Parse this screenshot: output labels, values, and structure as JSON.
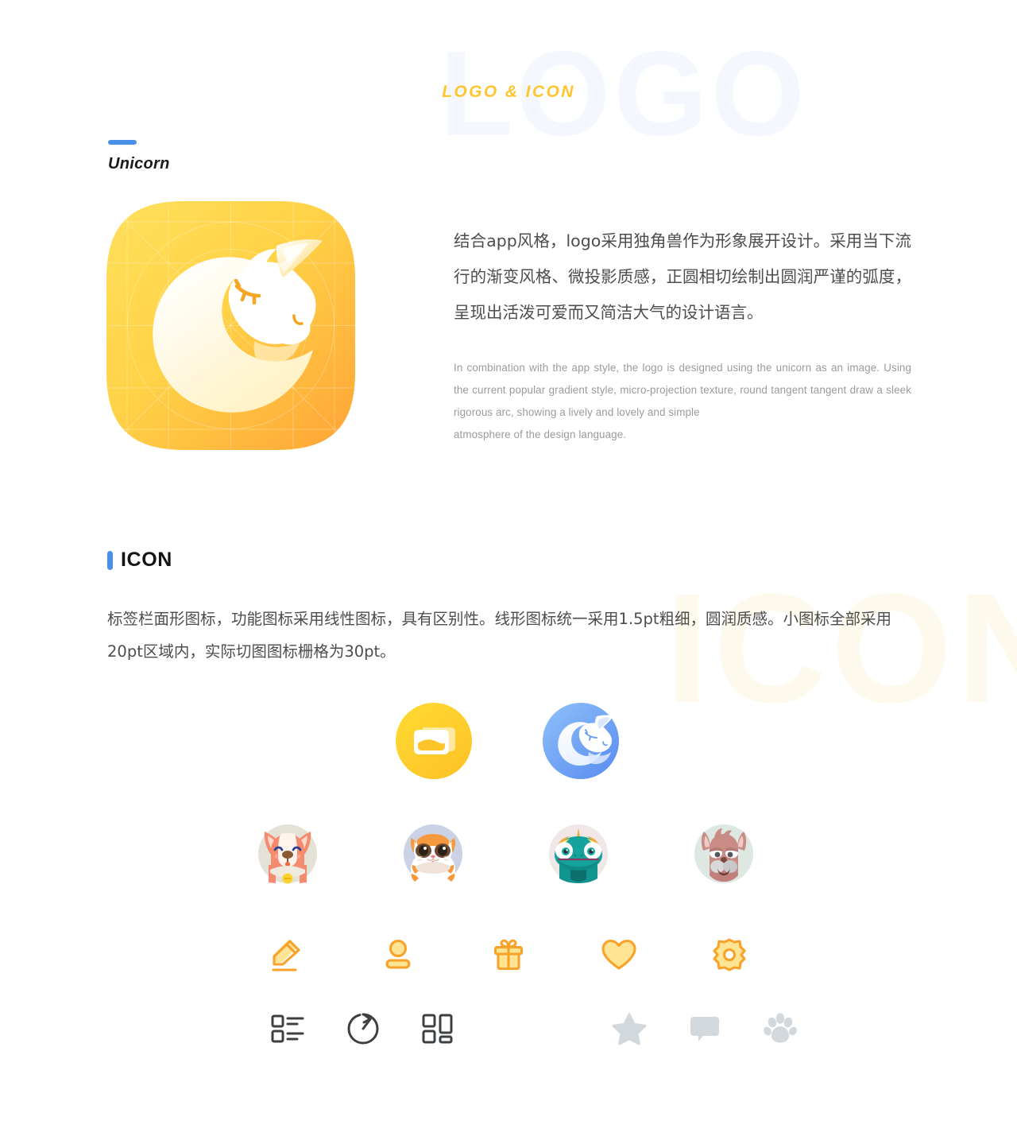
{
  "watermarks": {
    "logo": "LOGO",
    "icon": "ICON",
    "logo_color": "#f4f8fe",
    "icon_color": "#fdfaed"
  },
  "header": {
    "title": "LOGO & ICON",
    "title_color": "#ffc52e"
  },
  "sections": [
    {
      "id": "unicorn",
      "accent_color": "#4a90e8",
      "heading": "Unicorn",
      "app_icon": {
        "name": "unicorn-app-icon",
        "shape": "squircle",
        "gradient_from": "#ffd84d",
        "gradient_to": "#ffa93a",
        "subject": "white unicorn head with striped golden horn",
        "has_construction_grid": true
      },
      "copy_cn": "结合app风格，logo采用独角兽作为形象展开设计。采用当下流行的渐变风格、微投影质感，正圆相切绘制出圆润严谨的弧度，呈现出活泼可爱而又简洁大气的设计语言。",
      "copy_en": [
        "In combination with the app style, the logo is designed using the unicorn as an image. Using the current popular gradient style, micro-projection texture, round tangent tangent draw a sleek rigorous arc, showing a lively and lovely and simple",
        "atmosphere of the design language."
      ]
    },
    {
      "id": "icon",
      "accent_color": "#4a90e8",
      "heading": "ICON",
      "description": "标签栏面形图标，功能图标采用线性图标，具有区别性。线形图标统一采用1.5pt粗细，圆润质感。小图标全部采用20pt区域内，实际切图图标栅格为30pt。"
    }
  ],
  "icon_rows": [
    {
      "id": "tabbar-filled-icons",
      "style": "filled-circle",
      "items": [
        {
          "name": "gallery-icon",
          "label": "gallery",
          "circle_color": "#ffd42e",
          "glyph_color": "#ffffff"
        },
        {
          "name": "unicorn-icon",
          "label": "unicorn",
          "circle_color": "#6fa8f5",
          "glyph_color": "#ffffff"
        }
      ]
    },
    {
      "id": "animal-avatars",
      "style": "avatar-circle",
      "items": [
        {
          "name": "dog-avatar-icon",
          "label": "corgi dog",
          "circle_color": "#e3e0d6",
          "body_color": "#f58b6e"
        },
        {
          "name": "cat-avatar-icon",
          "label": "cat",
          "circle_color": "#cdd2e6",
          "body_color": "#f5993c"
        },
        {
          "name": "chameleon-avatar-icon",
          "label": "chameleon",
          "circle_color": "#f0e6e6",
          "body_color": "#18a09c"
        },
        {
          "name": "alpaca-avatar-icon",
          "label": "alpaca",
          "circle_color": "#dde8e2",
          "body_color": "#c98b85"
        }
      ]
    },
    {
      "id": "line-icons-yellow",
      "style": "line-icon",
      "stroke_color": "#f9a22a",
      "fill_color": "#ffe493",
      "items": [
        {
          "name": "edit-pencil-icon",
          "label": "edit"
        },
        {
          "name": "user-icon",
          "label": "user"
        },
        {
          "name": "gift-icon",
          "label": "gift"
        },
        {
          "name": "heart-icon",
          "label": "favorite"
        },
        {
          "name": "settings-gear-icon",
          "label": "settings"
        }
      ]
    },
    {
      "id": "line-icons-gray",
      "style": "line-icon",
      "stroke_color": "#3d4043",
      "muted_color": "#d3d8dc",
      "items": [
        {
          "name": "list-view-icon",
          "label": "list view",
          "tone": "dark"
        },
        {
          "name": "share-icon",
          "label": "share",
          "tone": "dark"
        },
        {
          "name": "grid-view-icon",
          "label": "grid view",
          "tone": "dark"
        },
        {
          "name": "star-icon",
          "label": "star",
          "tone": "muted"
        },
        {
          "name": "comment-icon",
          "label": "comment",
          "tone": "muted"
        },
        {
          "name": "paw-icon",
          "label": "paw",
          "tone": "muted"
        }
      ]
    }
  ]
}
